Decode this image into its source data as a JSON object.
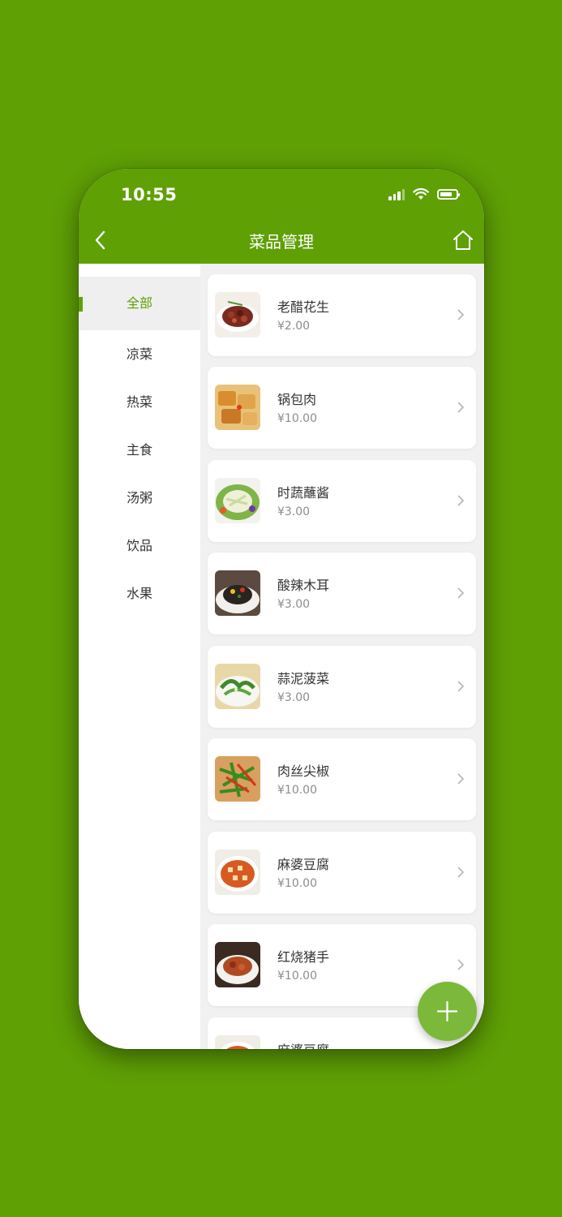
{
  "status": {
    "time": "10:55"
  },
  "nav": {
    "title": "菜品管理"
  },
  "categories": [
    {
      "label": "全部",
      "active": true
    },
    {
      "label": "凉菜"
    },
    {
      "label": "热菜"
    },
    {
      "label": "主食"
    },
    {
      "label": "汤粥"
    },
    {
      "label": "饮品"
    },
    {
      "label": "水果"
    }
  ],
  "dishes": [
    {
      "name": "老醋花生",
      "price": "¥2.00"
    },
    {
      "name": "锅包肉",
      "price": "¥10.00"
    },
    {
      "name": "时蔬蘸酱",
      "price": "¥3.00"
    },
    {
      "name": "酸辣木耳",
      "price": "¥3.00"
    },
    {
      "name": "蒜泥菠菜",
      "price": "¥3.00"
    },
    {
      "name": "肉丝尖椒",
      "price": "¥10.00"
    },
    {
      "name": "麻婆豆腐",
      "price": "¥10.00"
    },
    {
      "name": "红烧猪手",
      "price": "¥10.00"
    },
    {
      "name": "麻婆豆腐",
      "price": ""
    }
  ],
  "colors": {
    "brand": "#5fa005",
    "fab": "#7cb83a"
  }
}
